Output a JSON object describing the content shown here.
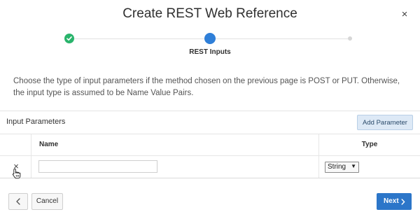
{
  "dialog": {
    "title": "Create REST Web Reference",
    "close_icon": "close-icon",
    "close_glyph": "×"
  },
  "wizard": {
    "steps": [
      {
        "state": "complete",
        "icon": "checkmark-icon"
      },
      {
        "state": "current",
        "label": "REST Inputs"
      },
      {
        "state": "upcoming"
      }
    ],
    "colors": {
      "complete": "#2ab46c",
      "current": "#2f7fd8",
      "upcoming": "#d6d6d6"
    }
  },
  "instructions": "Choose the type of input parameters if the method chosen on the previous page is POST or PUT. Otherwise, the input type is assumed to be Name Value Pairs.",
  "region": {
    "title": "Input Parameters",
    "add_button_label": "Add Parameter",
    "columns": {
      "name": "Name",
      "type": "Type"
    },
    "rows": [
      {
        "delete_icon": "delete-icon",
        "delete_glyph": "×",
        "name_value": "",
        "type_value": "String",
        "type_arrow": "▼"
      }
    ]
  },
  "footer": {
    "back_icon": "chevron-left-icon",
    "cancel_label": "Cancel",
    "next_label": "Next",
    "next_icon": "chevron-right-icon",
    "primary_color": "#2c76c9"
  }
}
